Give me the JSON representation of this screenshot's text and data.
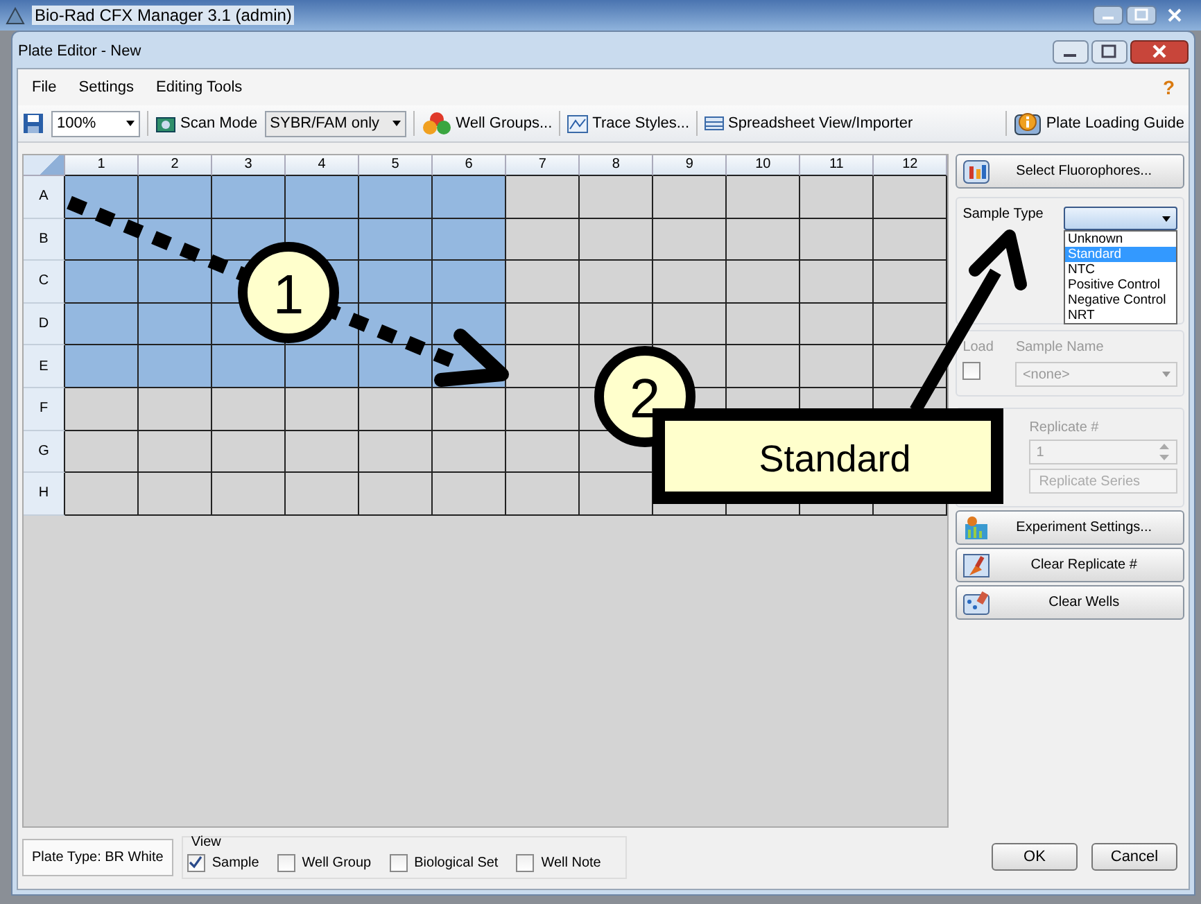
{
  "app_window": {
    "title": "Bio-Rad CFX Manager 3.1 (admin)"
  },
  "window": {
    "title": "Plate Editor - New"
  },
  "menu": [
    "File",
    "Settings",
    "Editing Tools"
  ],
  "help": "?",
  "toolbar": {
    "zoom": "100%",
    "scan_mode_label": "Scan Mode",
    "scan_mode": "SYBR/FAM only",
    "buttons": [
      {
        "kind": "groups",
        "label": "Well Groups..."
      },
      {
        "kind": "trace",
        "label": "Trace Styles..."
      },
      {
        "kind": "sheet",
        "label": "Spreadsheet View/Importer"
      }
    ],
    "guide": "Plate Loading Guide"
  },
  "plate": {
    "columns": [
      "1",
      "2",
      "3",
      "4",
      "5",
      "6",
      "7",
      "8",
      "9",
      "10",
      "11",
      "12"
    ],
    "rows": [
      {
        "label": "A",
        "selected": [
          true,
          true,
          true,
          true,
          true,
          true,
          false,
          false,
          false,
          false,
          false,
          false
        ]
      },
      {
        "label": "B",
        "selected": [
          true,
          true,
          true,
          true,
          true,
          true,
          false,
          false,
          false,
          false,
          false,
          false
        ]
      },
      {
        "label": "C",
        "selected": [
          true,
          true,
          true,
          true,
          true,
          true,
          false,
          false,
          false,
          false,
          false,
          false
        ]
      },
      {
        "label": "D",
        "selected": [
          true,
          true,
          true,
          true,
          true,
          true,
          false,
          false,
          false,
          false,
          false,
          false
        ]
      },
      {
        "label": "E",
        "selected": [
          true,
          true,
          true,
          true,
          true,
          true,
          false,
          false,
          false,
          false,
          false,
          false
        ]
      },
      {
        "label": "F",
        "selected": [
          false,
          false,
          false,
          false,
          false,
          false,
          false,
          false,
          false,
          false,
          false,
          false
        ]
      },
      {
        "label": "G",
        "selected": [
          false,
          false,
          false,
          false,
          false,
          false,
          false,
          false
        ]
      },
      {
        "label": "H",
        "selected": [
          false,
          false,
          false,
          false,
          false,
          false,
          false,
          false,
          false,
          false,
          false,
          false
        ]
      }
    ]
  },
  "side_panel": {
    "fluorophores_button": "Select Fluorophores...",
    "sample_type": {
      "label": "Sample Type",
      "options": [
        {
          "label": "Unknown",
          "selected": false
        },
        {
          "label": "Standard",
          "selected": true
        },
        {
          "label": "NTC",
          "selected": false
        },
        {
          "label": "Positive Control",
          "selected": false
        },
        {
          "label": "Negative Control",
          "selected": false
        },
        {
          "label": "NRT",
          "selected": false
        }
      ]
    },
    "load": {
      "label": "Load",
      "checked": false
    },
    "sample_name": {
      "label": "Sample Name",
      "value": "<none>"
    },
    "replicate": {
      "label": "Replicate #",
      "value": "1"
    },
    "replicate_series": "Replicate Series",
    "buttons": [
      {
        "kind": "experiment",
        "label": "Experiment Settings..."
      },
      {
        "kind": "clear-replicate",
        "label": "Clear Replicate #"
      },
      {
        "kind": "clear-wells",
        "label": "Clear Wells"
      }
    ]
  },
  "footer": {
    "plate_type": "Plate Type: BR White",
    "view_label": "View",
    "view_options": [
      {
        "label": "Sample",
        "checked": true
      },
      {
        "label": "Well Group",
        "checked": false
      },
      {
        "label": "Biological Set",
        "checked": false
      },
      {
        "label": "Well Note",
        "checked": false
      }
    ],
    "buttons": [
      "OK",
      "Cancel"
    ]
  },
  "annotations": [
    {
      "kind": "step",
      "label": "1"
    },
    {
      "kind": "step",
      "label": "2"
    },
    {
      "kind": "callout",
      "label": "Standard"
    }
  ]
}
